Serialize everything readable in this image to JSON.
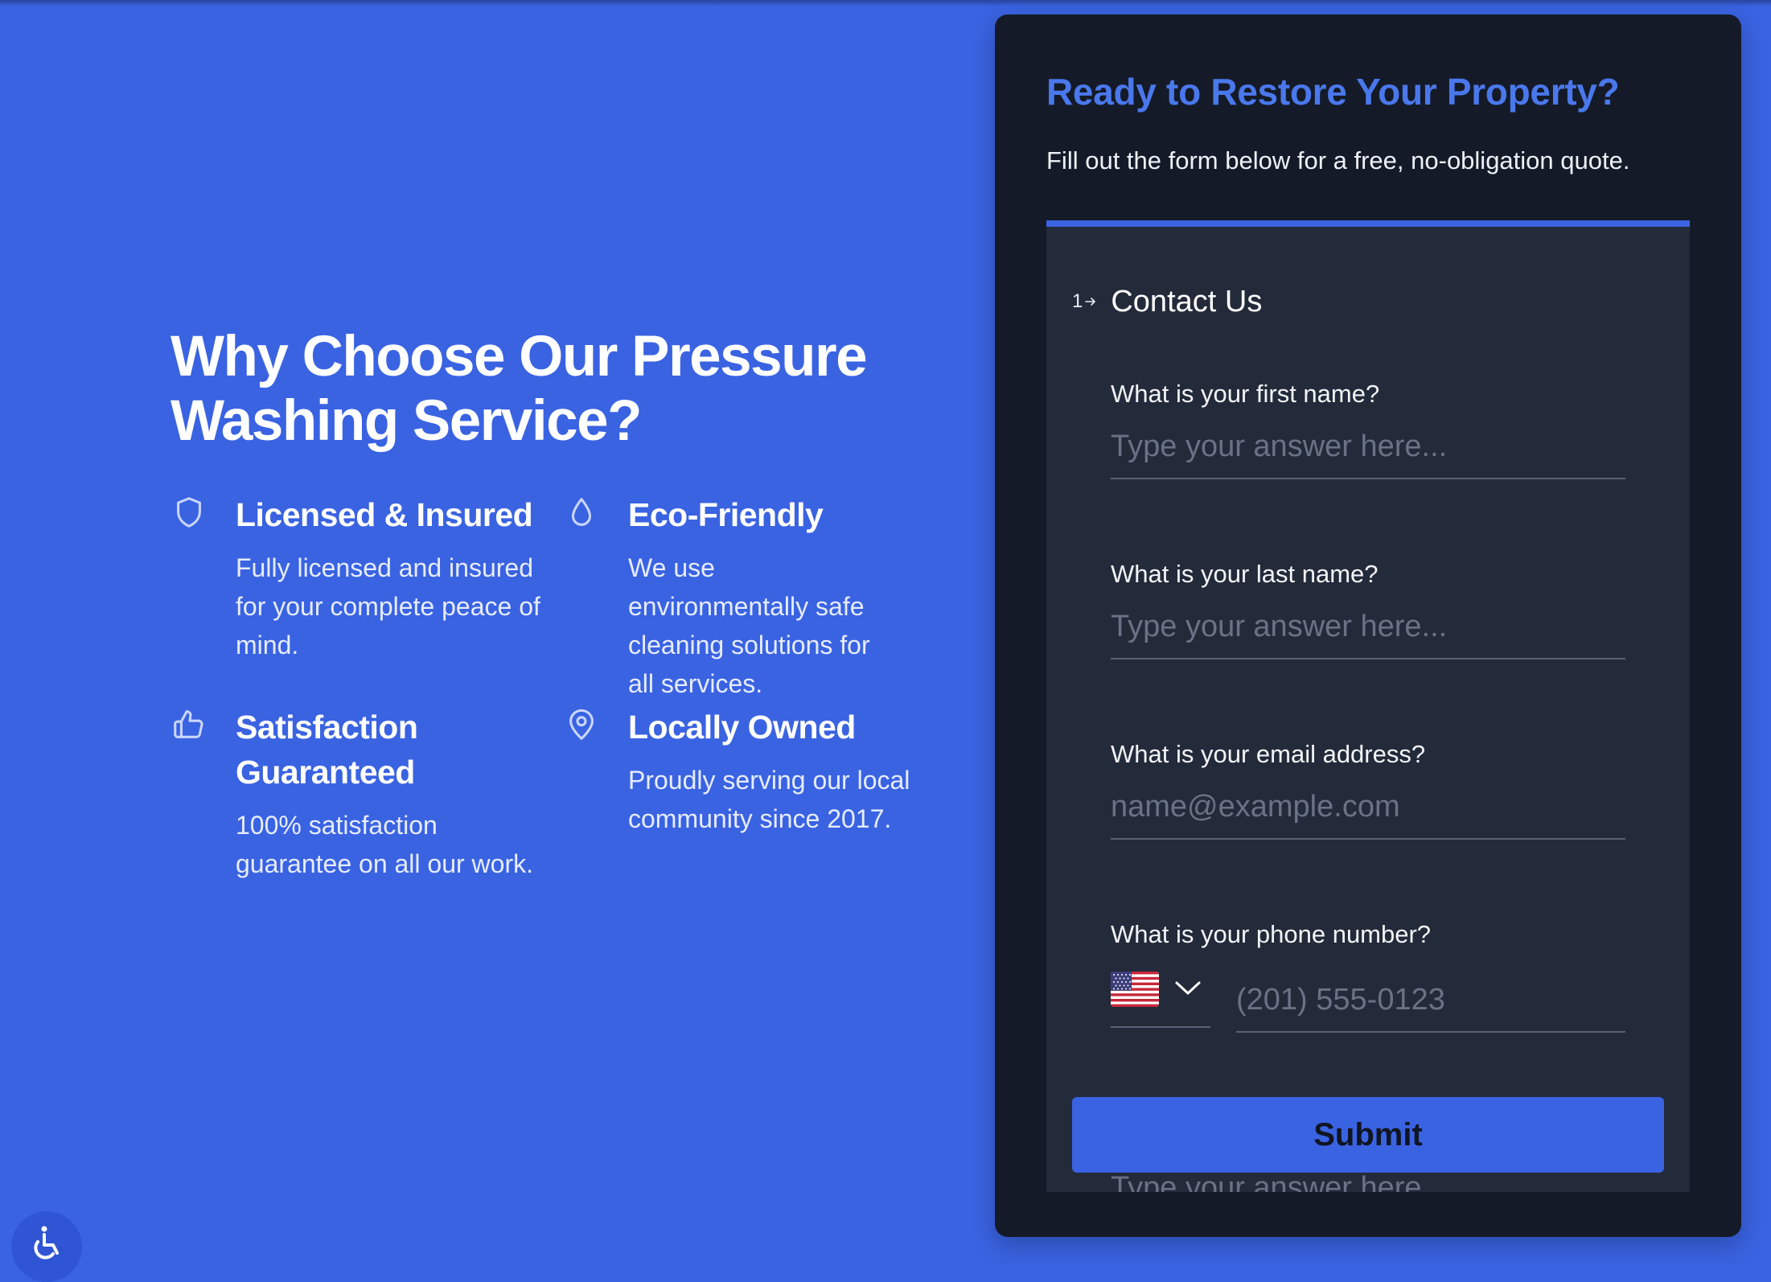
{
  "left": {
    "headline": "Why Choose Our Pressure Washing Service?",
    "features": [
      {
        "icon": "shield-icon",
        "title": "Licensed & Insured",
        "description": "Fully licensed and insured for your complete peace of mind."
      },
      {
        "icon": "droplet-icon",
        "title": "Eco-Friendly",
        "description": "We use environmentally safe cleaning solutions for all services."
      },
      {
        "icon": "thumbs-up-icon",
        "title": "Satisfaction Guaranteed",
        "description": "100% satisfaction guarantee on all our work."
      },
      {
        "icon": "map-pin-icon",
        "title": "Locally Owned",
        "description": "Proudly serving our local community since 2017."
      }
    ]
  },
  "card": {
    "title": "Ready to Restore Your Property?",
    "subtitle": "Fill out the form below for a free, no-obligation quote.",
    "form": {
      "step_number": "1",
      "step_title": "Contact Us",
      "fields": {
        "first_name": {
          "label": "What is your first name?",
          "placeholder": "Type your answer here...",
          "value": ""
        },
        "last_name": {
          "label": "What is your last name?",
          "placeholder": "Type your answer here...",
          "value": ""
        },
        "email": {
          "label": "What is your email address?",
          "placeholder": "name@example.com",
          "value": ""
        },
        "phone": {
          "label": "What is your phone number?",
          "country": "US",
          "placeholder": "(201) 555-0123",
          "value": ""
        }
      },
      "submit_label": "Submit",
      "next_placeholder": "Type your answer here..."
    }
  },
  "colors": {
    "background": "#3a63e2",
    "card": "#141a28",
    "form_panel": "#232a3a",
    "accent": "#4a78ec"
  },
  "accessibility": {
    "icon": "accessibility-icon"
  }
}
